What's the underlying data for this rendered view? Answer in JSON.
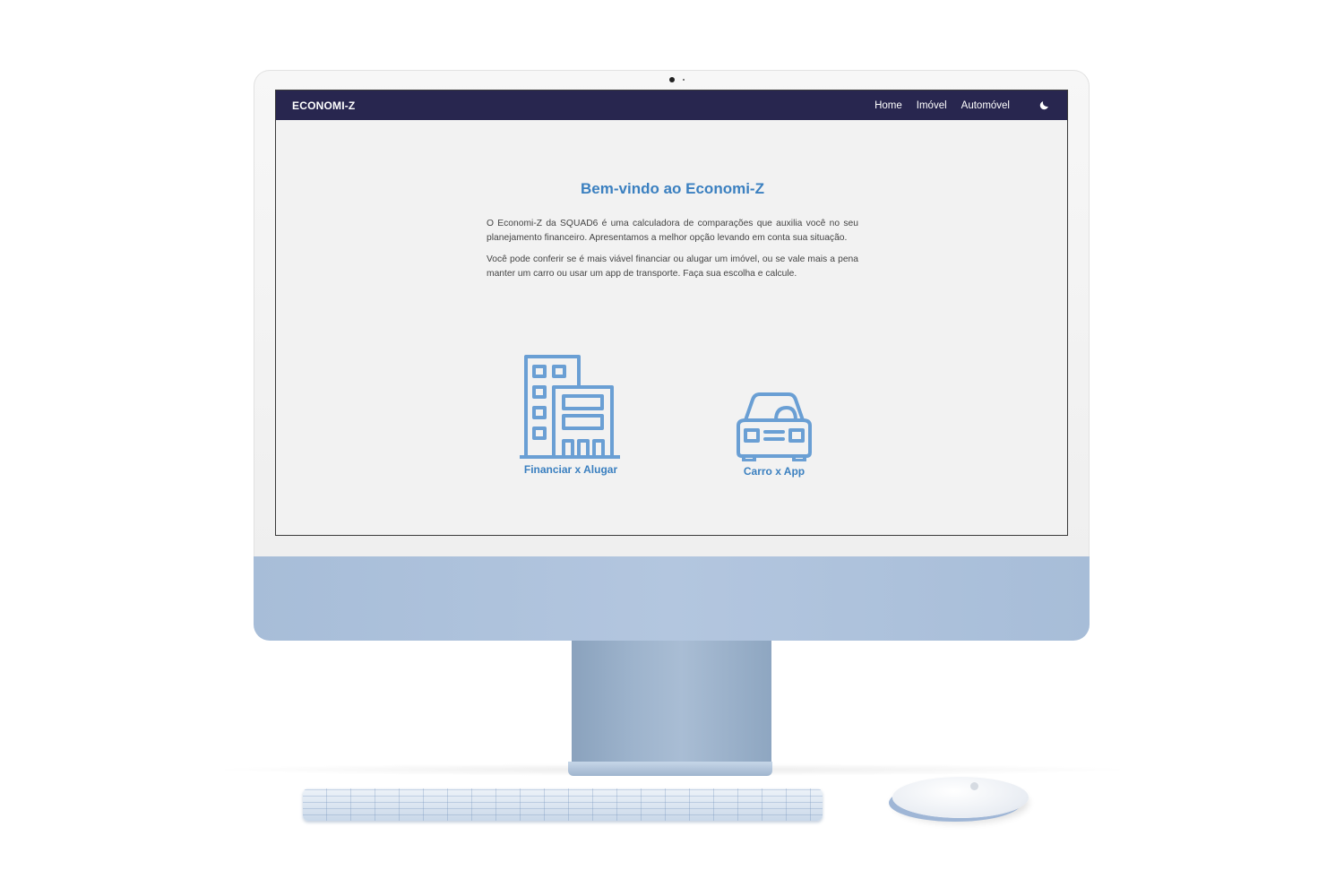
{
  "navbar": {
    "brand": "ECONOMI-Z",
    "links": [
      "Home",
      "Imóvel",
      "Automóvel"
    ],
    "theme_icon": "moon-icon"
  },
  "main": {
    "title": "Bem-vindo ao Economi-Z",
    "paragraphs": [
      "O Economi-Z da SQUAD6 é uma calculadora de comparações que auxilia você no seu planejamento financeiro. Apresentamos a melhor opção levando em conta sua situação.",
      "Você pode conferir se é mais viável financiar ou alugar um imóvel, ou se vale mais a pena manter um carro ou usar um app de transporte. Faça sua escolha e calcule."
    ],
    "cards": [
      {
        "label": "Financiar x Alugar",
        "icon": "building-icon"
      },
      {
        "label": "Carro x App",
        "icon": "car-icon"
      }
    ]
  },
  "colors": {
    "navbar_bg": "#28264f",
    "accent": "#3b80c0",
    "icon": "#6a9fd4",
    "page_bg": "#f2f2f2"
  }
}
